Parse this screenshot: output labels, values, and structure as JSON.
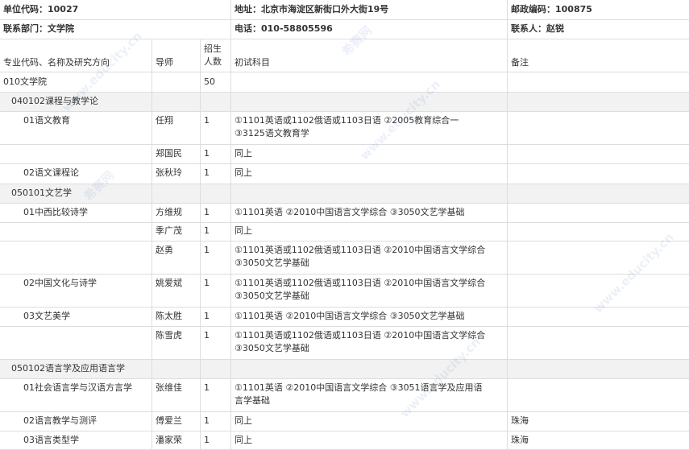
{
  "header": {
    "unit_code": "单位代码：10027",
    "address": "地址：北京市海淀区新街口外大街19号",
    "postal_code": "邮政编码：100875",
    "dept": "联系部门：文学院",
    "phone": "电话：010-58805596",
    "contact": "联系人：赵锐"
  },
  "columns": {
    "major": "专业代码、名称及研究方向",
    "advisor": "导师",
    "enroll_1": "招生",
    "enroll_2": "人数",
    "exam": "初试科目",
    "note": "备注"
  },
  "rows": {
    "college": {
      "name": "010文学院",
      "count": "50"
    },
    "s1": {
      "name": "040102课程与教学论"
    },
    "r1": {
      "dir": "01语文教育",
      "advisor": "任翔",
      "count": "1",
      "exam1": "①1101英语或1102俄语或1103日语 ②2005教育综合一",
      "exam2": "③3125语文教育学"
    },
    "r2": {
      "advisor": "郑国民",
      "count": "1",
      "exam1": "同上"
    },
    "r3": {
      "dir": "02语文课程论",
      "advisor": "张秋玲",
      "count": "1",
      "exam1": "同上"
    },
    "s2": {
      "name": "050101文艺学"
    },
    "r4": {
      "dir": "01中西比较诗学",
      "advisor": "方维规",
      "count": "1",
      "exam1": "①1101英语 ②2010中国语言文学综合 ③3050文艺学基础"
    },
    "r5": {
      "advisor": "季广茂",
      "count": "1",
      "exam1": "同上"
    },
    "r6": {
      "advisor": "赵勇",
      "count": "1",
      "exam1": "①1101英语或1102俄语或1103日语 ②2010中国语言文学综合",
      "exam2": "③3050文艺学基础"
    },
    "r7": {
      "dir": "02中国文化与诗学",
      "advisor": "姚爱斌",
      "count": "1",
      "exam1": "①1101英语或1102俄语或1103日语 ②2010中国语言文学综合",
      "exam2": "③3050文艺学基础"
    },
    "r8": {
      "dir": "03文艺美学",
      "advisor": "陈太胜",
      "count": "1",
      "exam1": "①1101英语 ②2010中国语言文学综合 ③3050文艺学基础"
    },
    "r9": {
      "advisor": "陈雪虎",
      "count": "1",
      "exam1": "①1101英语或1102俄语或1103日语 ②2010中国语言文学综合",
      "exam2": "③3050文艺学基础"
    },
    "s3": {
      "name": "050102语言学及应用语言学"
    },
    "r10": {
      "dir": "01社会语言学与汉语方言学",
      "advisor": "张维佳",
      "count": "1",
      "exam1": "①1101英语 ②2010中国语言文学综合 ③3051语言学及应用语",
      "exam2": "言学基础"
    },
    "r11": {
      "dir": "02语言教学与测评",
      "advisor": "傅爱兰",
      "count": "1",
      "exam1": "同上",
      "note": "珠海"
    },
    "r12": {
      "dir": "03语言类型学",
      "advisor": "潘家荣",
      "count": "1",
      "exam1": "同上",
      "note": "珠海"
    }
  },
  "watermark": {
    "brand": "希赛网",
    "url": "www.educity.cn"
  }
}
